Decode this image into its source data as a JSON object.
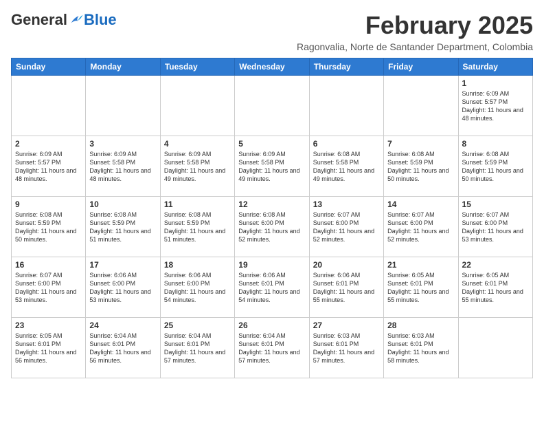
{
  "header": {
    "logo_general": "General",
    "logo_blue": "Blue",
    "month_year": "February 2025",
    "location": "Ragonvalia, Norte de Santander Department, Colombia"
  },
  "weekdays": [
    "Sunday",
    "Monday",
    "Tuesday",
    "Wednesday",
    "Thursday",
    "Friday",
    "Saturday"
  ],
  "weeks": [
    [
      {
        "day": "",
        "info": ""
      },
      {
        "day": "",
        "info": ""
      },
      {
        "day": "",
        "info": ""
      },
      {
        "day": "",
        "info": ""
      },
      {
        "day": "",
        "info": ""
      },
      {
        "day": "",
        "info": ""
      },
      {
        "day": "1",
        "info": "Sunrise: 6:09 AM\nSunset: 5:57 PM\nDaylight: 11 hours and 48 minutes."
      }
    ],
    [
      {
        "day": "2",
        "info": "Sunrise: 6:09 AM\nSunset: 5:57 PM\nDaylight: 11 hours and 48 minutes."
      },
      {
        "day": "3",
        "info": "Sunrise: 6:09 AM\nSunset: 5:58 PM\nDaylight: 11 hours and 48 minutes."
      },
      {
        "day": "4",
        "info": "Sunrise: 6:09 AM\nSunset: 5:58 PM\nDaylight: 11 hours and 49 minutes."
      },
      {
        "day": "5",
        "info": "Sunrise: 6:09 AM\nSunset: 5:58 PM\nDaylight: 11 hours and 49 minutes."
      },
      {
        "day": "6",
        "info": "Sunrise: 6:08 AM\nSunset: 5:58 PM\nDaylight: 11 hours and 49 minutes."
      },
      {
        "day": "7",
        "info": "Sunrise: 6:08 AM\nSunset: 5:59 PM\nDaylight: 11 hours and 50 minutes."
      },
      {
        "day": "8",
        "info": "Sunrise: 6:08 AM\nSunset: 5:59 PM\nDaylight: 11 hours and 50 minutes."
      }
    ],
    [
      {
        "day": "9",
        "info": "Sunrise: 6:08 AM\nSunset: 5:59 PM\nDaylight: 11 hours and 50 minutes."
      },
      {
        "day": "10",
        "info": "Sunrise: 6:08 AM\nSunset: 5:59 PM\nDaylight: 11 hours and 51 minutes."
      },
      {
        "day": "11",
        "info": "Sunrise: 6:08 AM\nSunset: 5:59 PM\nDaylight: 11 hours and 51 minutes."
      },
      {
        "day": "12",
        "info": "Sunrise: 6:08 AM\nSunset: 6:00 PM\nDaylight: 11 hours and 52 minutes."
      },
      {
        "day": "13",
        "info": "Sunrise: 6:07 AM\nSunset: 6:00 PM\nDaylight: 11 hours and 52 minutes."
      },
      {
        "day": "14",
        "info": "Sunrise: 6:07 AM\nSunset: 6:00 PM\nDaylight: 11 hours and 52 minutes."
      },
      {
        "day": "15",
        "info": "Sunrise: 6:07 AM\nSunset: 6:00 PM\nDaylight: 11 hours and 53 minutes."
      }
    ],
    [
      {
        "day": "16",
        "info": "Sunrise: 6:07 AM\nSunset: 6:00 PM\nDaylight: 11 hours and 53 minutes."
      },
      {
        "day": "17",
        "info": "Sunrise: 6:06 AM\nSunset: 6:00 PM\nDaylight: 11 hours and 53 minutes."
      },
      {
        "day": "18",
        "info": "Sunrise: 6:06 AM\nSunset: 6:00 PM\nDaylight: 11 hours and 54 minutes."
      },
      {
        "day": "19",
        "info": "Sunrise: 6:06 AM\nSunset: 6:01 PM\nDaylight: 11 hours and 54 minutes."
      },
      {
        "day": "20",
        "info": "Sunrise: 6:06 AM\nSunset: 6:01 PM\nDaylight: 11 hours and 55 minutes."
      },
      {
        "day": "21",
        "info": "Sunrise: 6:05 AM\nSunset: 6:01 PM\nDaylight: 11 hours and 55 minutes."
      },
      {
        "day": "22",
        "info": "Sunrise: 6:05 AM\nSunset: 6:01 PM\nDaylight: 11 hours and 55 minutes."
      }
    ],
    [
      {
        "day": "23",
        "info": "Sunrise: 6:05 AM\nSunset: 6:01 PM\nDaylight: 11 hours and 56 minutes."
      },
      {
        "day": "24",
        "info": "Sunrise: 6:04 AM\nSunset: 6:01 PM\nDaylight: 11 hours and 56 minutes."
      },
      {
        "day": "25",
        "info": "Sunrise: 6:04 AM\nSunset: 6:01 PM\nDaylight: 11 hours and 57 minutes."
      },
      {
        "day": "26",
        "info": "Sunrise: 6:04 AM\nSunset: 6:01 PM\nDaylight: 11 hours and 57 minutes."
      },
      {
        "day": "27",
        "info": "Sunrise: 6:03 AM\nSunset: 6:01 PM\nDaylight: 11 hours and 57 minutes."
      },
      {
        "day": "28",
        "info": "Sunrise: 6:03 AM\nSunset: 6:01 PM\nDaylight: 11 hours and 58 minutes."
      },
      {
        "day": "",
        "info": ""
      }
    ]
  ]
}
